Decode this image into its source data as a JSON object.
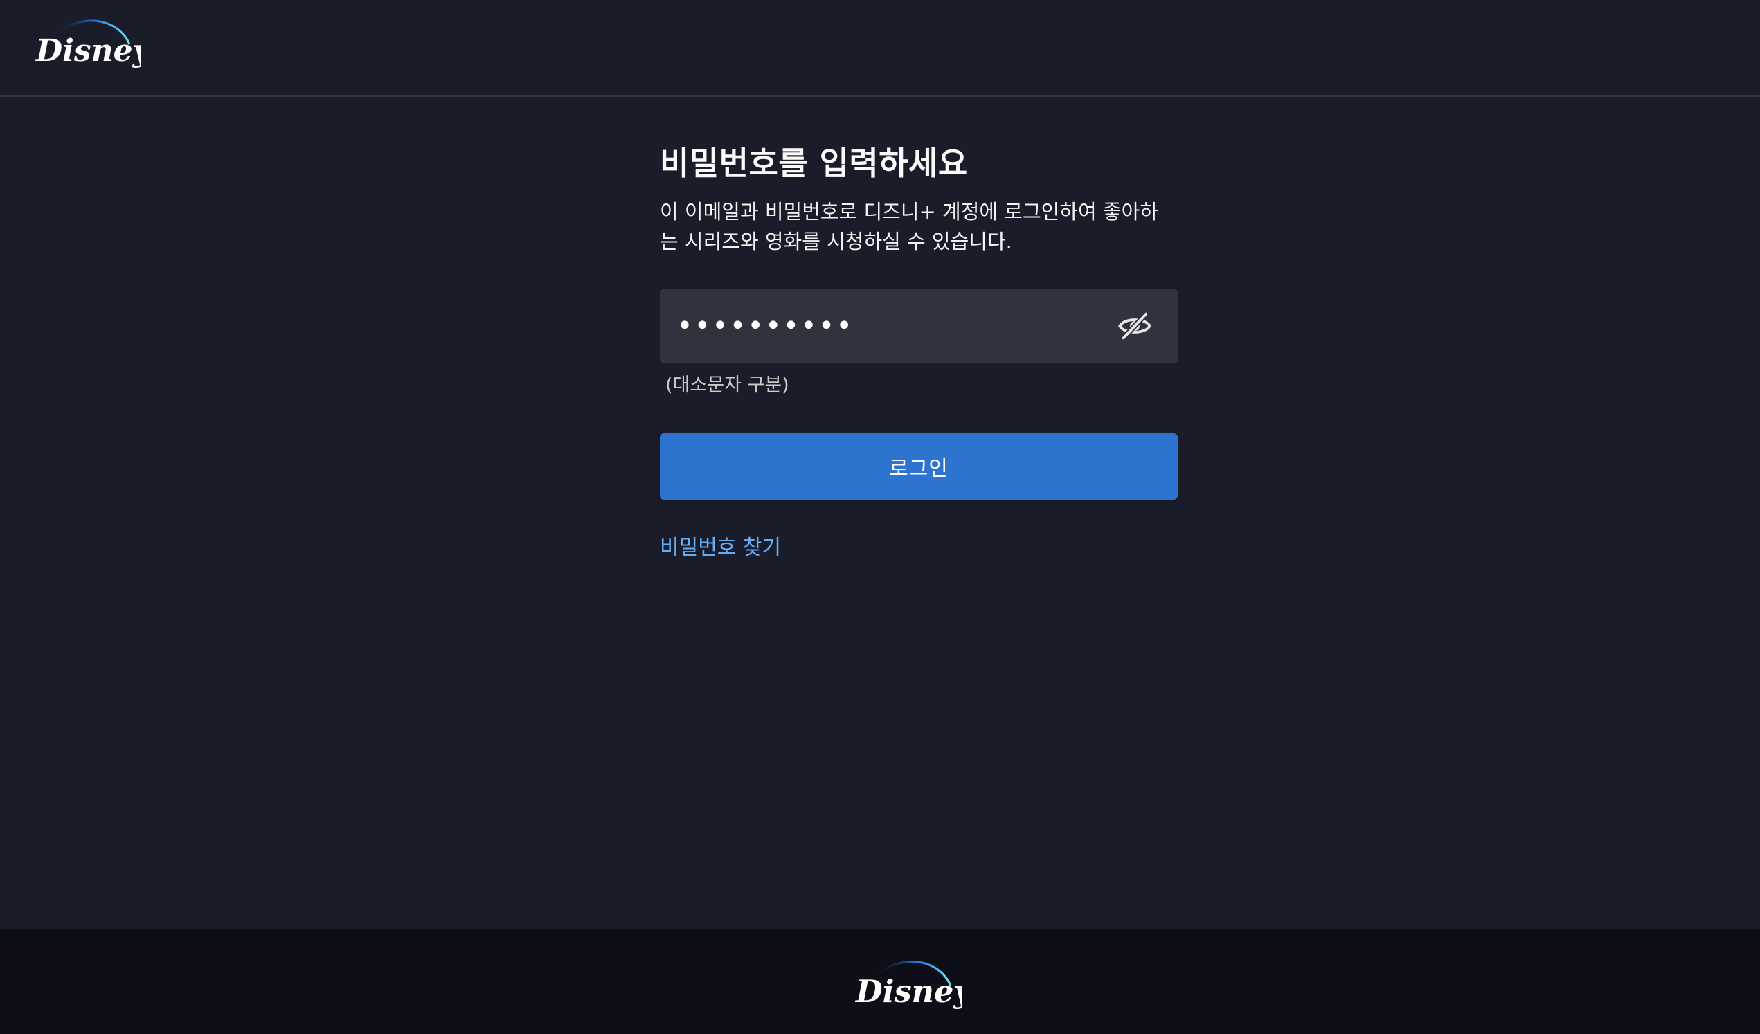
{
  "header": {
    "logo_text": "Disney+"
  },
  "main": {
    "title": "비밀번호를 입력하세요",
    "description": "이 이메일과 비밀번호로 디즈니+ 계정에 로그인하여 좋아하는 시리즈와 영화를 시청하실 수 있습니다.",
    "password_value": "••••••••••",
    "toggle_icon": "eye-slash-icon",
    "hint": "(대소문자 구분)",
    "login_label": "로그인",
    "forgot_password_label": "비밀번호 찾기"
  },
  "footer": {
    "logo_text": "Disney+"
  },
  "colors": {
    "background": "#1a1d29",
    "input_background": "#30323d",
    "primary_button": "#2d74d0",
    "link": "#63aef7",
    "footer_background": "#0e0e18"
  }
}
